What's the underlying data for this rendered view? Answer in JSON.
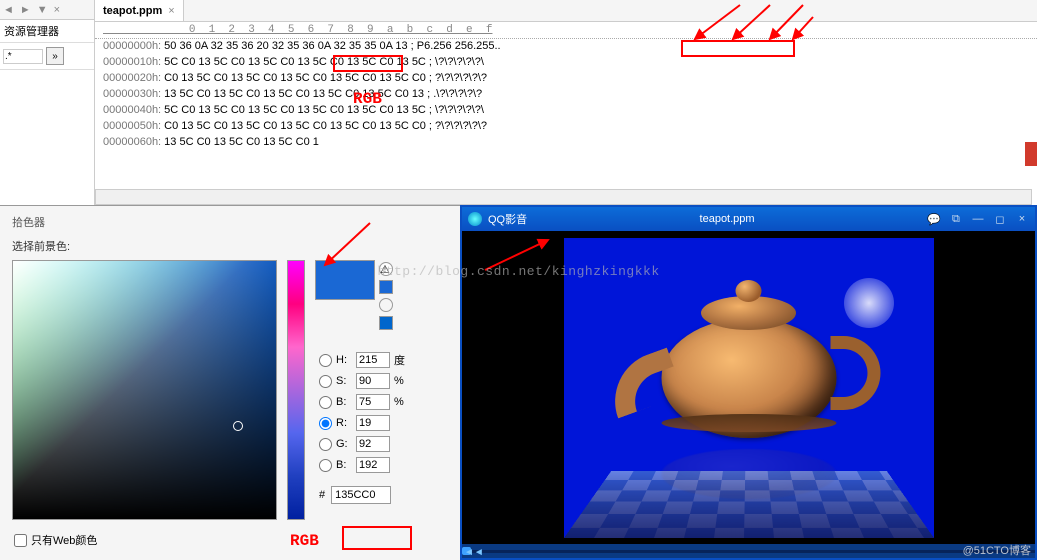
{
  "leftPane": {
    "tabs": [
      "◄",
      "►",
      "▼",
      "×"
    ],
    "title": "资源管理器",
    "filter": ".*",
    "btn": "»"
  },
  "tab": {
    "name": "teapot.ppm",
    "close": "×"
  },
  "hex": {
    "header": "             0  1  2  3  4  5  6  7  8  9  a  b  c  d  e  f",
    "rows": [
      {
        "a": "00000000h:",
        "b": " 50 36 0A 32 35 36 20 32 35 36 0A 32 35 35 0A 13 ; ",
        "c": "P6.256 256.255.."
      },
      {
        "a": "00000010h:",
        "b": " 5C C0 13 5C C0 13 5C C0 13 5C C0 13 5C C0 13 5C ; ",
        "c": "\\?\\?\\?\\?\\?\\"
      },
      {
        "a": "00000020h:",
        "b": " C0 13 5C C0 13 5C C0 13 5C C0 13 5C C0 13 5C C0 ; ",
        "c": "?\\?\\?\\?\\?\\?"
      },
      {
        "a": "00000030h:",
        "b": " 13 5C C0 13 5C C0 13 5C C0 13 5C C0 13 5C C0 13 ; ",
        "c": ".\\?\\?\\?\\?\\?"
      },
      {
        "a": "00000040h:",
        "b": " 5C C0 13 5C C0 13 5C C0 13 5C C0 13 5C C0 13 5C ; ",
        "c": "\\?\\?\\?\\?\\?\\"
      },
      {
        "a": "00000050h:",
        "b": " C0 13 5C C0 13 5C C0 13 5C C0 13 5C C0 13 5C C0 ; ",
        "c": "?\\?\\?\\?\\?\\?"
      },
      {
        "a": "00000060h:",
        "b": " 13 5C C0 13 5C C0 13 5C C0 1",
        "c": ""
      }
    ],
    "rgb": "RGB"
  },
  "picker": {
    "title": "拾色器",
    "subtitle": "选择前景色:",
    "H": {
      "l": "H:",
      "v": "215",
      "u": "度"
    },
    "S": {
      "l": "S:",
      "v": "90",
      "u": "%"
    },
    "Bv": {
      "l": "B:",
      "v": "75",
      "u": "%"
    },
    "R": {
      "l": "R:",
      "v": "19"
    },
    "G": {
      "l": "G:",
      "v": "92"
    },
    "B": {
      "l": "B:",
      "v": "192"
    },
    "hex": {
      "l": "#",
      "v": "135CC0"
    },
    "rgb": "RGB",
    "webOnly": "只有Web颜色"
  },
  "player": {
    "brand": "QQ影音",
    "file": "teapot.ppm",
    "btns": [
      "💬",
      "⧉",
      "—",
      "◻",
      "×"
    ]
  },
  "watermark": "http://blog.csdn.net/kinghzkingkkk",
  "credit": "@51CTO博客"
}
